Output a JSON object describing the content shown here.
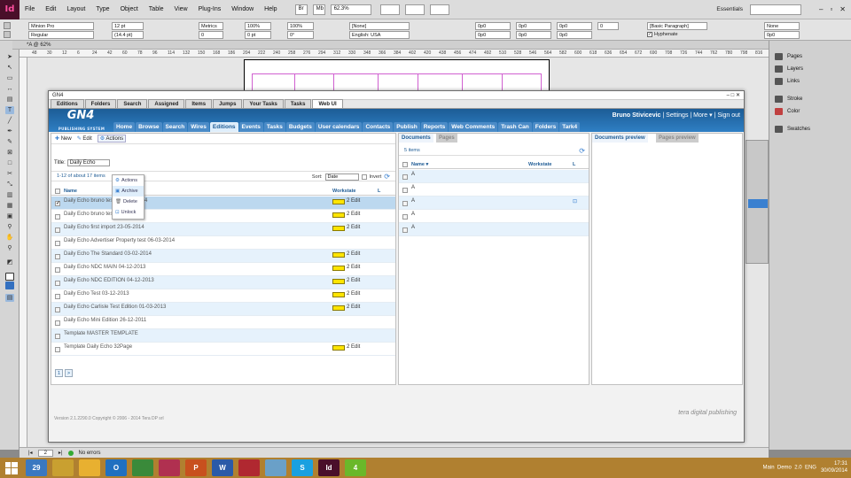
{
  "indesign": {
    "app_icon": "Id",
    "menus": [
      "File",
      "Edit",
      "Layout",
      "Type",
      "Object",
      "Table",
      "View",
      "Plug-Ins",
      "Window",
      "Help"
    ],
    "zoom": "62.3%",
    "workspace": "Essentials",
    "font_name": "Minion Pro",
    "font_style": "Regular",
    "font_size": "12 pt",
    "leading": "(14.4 pt)",
    "kerning": "Metrics",
    "tracking": "0",
    "hscale": "100%",
    "vscale": "100%",
    "baseline": "0 pt",
    "skew": "0°",
    "char_style": "[None]",
    "language": "English: USA",
    "para_style": "[Basic Paragraph]",
    "hyphenate": "Hyphenate",
    "none_label": "None",
    "indent_values": [
      "0p0",
      "0p0",
      "0p0",
      "0p0",
      "0p0",
      "0p0",
      "0"
    ],
    "doc_tab": "*A @ 62%",
    "ruler_ticks": [
      "48",
      "30",
      "12",
      "6",
      "24",
      "42",
      "60",
      "78",
      "96",
      "114",
      "132",
      "150",
      "168",
      "186",
      "204",
      "222",
      "240",
      "258",
      "276",
      "294",
      "312",
      "330",
      "348",
      "366",
      "384",
      "402",
      "420",
      "438",
      "456",
      "474",
      "492",
      "510",
      "528",
      "546",
      "564",
      "582",
      "600",
      "618",
      "636",
      "654",
      "672",
      "690",
      "708",
      "726",
      "744",
      "762",
      "780",
      "798",
      "816",
      "834"
    ],
    "page_number": "2",
    "status_preflight": "No errors",
    "panels": [
      "Pages",
      "Layers",
      "Links",
      "Stroke",
      "Color",
      "Swatches"
    ]
  },
  "gn4": {
    "window_title": "GN4",
    "tabs": [
      "Editions",
      "Folders",
      "Search",
      "Assigned",
      "Items",
      "Jumps",
      "Your Tasks",
      "Tasks",
      "Web UI"
    ],
    "active_tab": "Web UI",
    "logo_text": "GN4",
    "logo_sub": "PUBLISHING SYSTEM",
    "nav": [
      "Home",
      "Browse",
      "Search",
      "Wires",
      "Editions",
      "Events",
      "Tasks",
      "Budgets",
      "User calendars",
      "Contacts",
      "Publish",
      "Reports",
      "Web Comments",
      "Trash Can",
      "Folders",
      "Tark4"
    ],
    "active_nav": "Editions",
    "user_name": "Bruno Stivicevic",
    "settings": "Settings",
    "more": "More",
    "sign_out": "Sign out",
    "toolbar": {
      "new": "New",
      "edit": "Edit",
      "actions": "Actions"
    },
    "actions_menu": [
      "Archive",
      "Delete",
      "Unlock"
    ],
    "title_label": "Title:",
    "title_value": "Daily Echo",
    "count_text": "1-12 of about 17 items",
    "sort_label": "Sort:",
    "sort_value": "Date",
    "invert_label": "Invert",
    "columns": {
      "name": "Name",
      "workstate": "Workstate",
      "l": "L"
    },
    "rows": [
      {
        "name": "Daily Echo bruno test 2 30-09-2014",
        "state": "2 Edit",
        "selected": true
      },
      {
        "name": "Daily Echo bruno test 29-09-2014",
        "state": "2 Edit",
        "selected": false
      },
      {
        "name": "Daily Echo first import 23-05-2014",
        "state": "2 Edit",
        "selected": false
      },
      {
        "name": "Daily Echo Advertiser Property test 06-03-2014",
        "state": "",
        "selected": false
      },
      {
        "name": "Daily Echo The Standard 03-02-2014",
        "state": "2 Edit",
        "selected": false
      },
      {
        "name": "Daily Echo NDC MAIN 04-12-2013",
        "state": "2 Edit",
        "selected": false
      },
      {
        "name": "Daily Echo NDC EDITION 04-12-2013",
        "state": "2 Edit",
        "selected": false
      },
      {
        "name": "Daily Echo Test 03-12-2013",
        "state": "2 Edit",
        "selected": false
      },
      {
        "name": "Daily Echo Carlisle Test Edition 01-03-2013",
        "state": "2 Edit",
        "selected": false
      },
      {
        "name": "Daily Echo Mini Edition 26-12-2011",
        "state": "",
        "selected": false
      },
      {
        "name": "Template MASTER TEMPLATE",
        "state": "",
        "selected": false
      },
      {
        "name": "Template Daily Echo 32Page",
        "state": "2 Edit",
        "selected": false
      }
    ],
    "pager": [
      "1",
      ">"
    ],
    "documents_tab": "Documents",
    "pages_tab": "Pages",
    "docs_count": "5 items",
    "doc_rows": [
      "A",
      "A",
      "A",
      "A",
      "A"
    ],
    "preview_tab": "Documents preview",
    "pages_preview_tab": "Pages preview",
    "version": "Version 2.1.2290.0 Copyright © 2006 - 2014 Tera DP srl",
    "tera": "tera digital publishing"
  },
  "taskbar": {
    "apps": [
      "29",
      "",
      "",
      "O",
      "",
      "",
      "P",
      "W",
      "",
      "",
      "S",
      "Id",
      "4"
    ],
    "app_colors": [
      "#3a78c0",
      "#c9a030",
      "#e8b030",
      "#2070c0",
      "#3a8a3a",
      "#b03050",
      "#c8501e",
      "#2a5aa8",
      "#b02830",
      "#6aa0c8",
      "#1aa0e0",
      "#4a0f2a",
      "#6ab82a"
    ],
    "tray": [
      "Main",
      "Demo",
      "2.0",
      "ENG"
    ],
    "time": "17:31",
    "date": "30/09/2014"
  }
}
